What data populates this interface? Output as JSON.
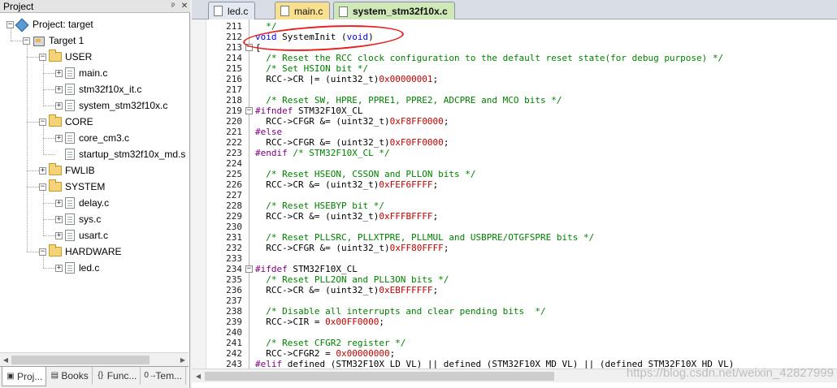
{
  "project_panel": {
    "title": "Project",
    "pin_icon": "pin-icon",
    "close_icon": "close-icon",
    "tree": [
      {
        "label": "Project: target",
        "icon": "project-icon",
        "expander": "−",
        "level": 0
      },
      {
        "label": "Target 1",
        "icon": "target-icon",
        "expander": "−",
        "level": 1
      },
      {
        "label": "USER",
        "icon": "folder-icon",
        "expander": "−",
        "level": 2
      },
      {
        "label": "main.c",
        "icon": "file-icon",
        "expander": "+",
        "level": 3
      },
      {
        "label": "stm32f10x_it.c",
        "icon": "file-icon",
        "expander": "+",
        "level": 3
      },
      {
        "label": "system_stm32f10x.c",
        "icon": "file-icon",
        "expander": "+",
        "level": 3
      },
      {
        "label": "CORE",
        "icon": "folder-icon",
        "expander": "−",
        "level": 2
      },
      {
        "label": "core_cm3.c",
        "icon": "file-icon",
        "expander": "+",
        "level": 3
      },
      {
        "label": "startup_stm32f10x_md.s",
        "icon": "file-icon",
        "expander": "",
        "level": 3
      },
      {
        "label": "FWLIB",
        "icon": "folder-icon",
        "expander": "+",
        "level": 2
      },
      {
        "label": "SYSTEM",
        "icon": "folder-icon",
        "expander": "−",
        "level": 2
      },
      {
        "label": "delay.c",
        "icon": "file-icon",
        "expander": "+",
        "level": 3
      },
      {
        "label": "sys.c",
        "icon": "file-icon",
        "expander": "+",
        "level": 3
      },
      {
        "label": "usart.c",
        "icon": "file-icon",
        "expander": "+",
        "level": 3
      },
      {
        "label": "HARDWARE",
        "icon": "folder-icon",
        "expander": "−",
        "level": 2
      },
      {
        "label": "led.c",
        "icon": "file-icon",
        "expander": "+",
        "level": 3
      }
    ],
    "bottom_tabs": [
      {
        "label": "Proj...",
        "icon": "project-tab-icon",
        "glyph": "▣"
      },
      {
        "label": "Books",
        "icon": "books-icon",
        "glyph": "▤"
      },
      {
        "label": "Func...",
        "icon": "functions-icon",
        "glyph": "{}"
      },
      {
        "label": "Tem...",
        "icon": "templates-icon",
        "glyph": "0→"
      }
    ]
  },
  "editor": {
    "tabs": [
      {
        "label": "led.c",
        "style": "plain"
      },
      {
        "label": "main.c",
        "style": "yellow"
      },
      {
        "label": "system_stm32f10x.c",
        "style": "active"
      }
    ],
    "lines": [
      {
        "n": "211",
        "fold": "",
        "parts": [
          {
            "t": "  */",
            "c": "cm"
          }
        ]
      },
      {
        "n": "212",
        "fold": "",
        "parts": [
          {
            "t": "void",
            "c": "kw"
          },
          {
            "t": " SystemInit (",
            "c": ""
          },
          {
            "t": "void",
            "c": "kw"
          },
          {
            "t": ")",
            "c": ""
          }
        ]
      },
      {
        "n": "213",
        "fold": "−",
        "parts": [
          {
            "t": "{",
            "c": ""
          }
        ]
      },
      {
        "n": "214",
        "fold": "",
        "parts": [
          {
            "t": "  /* Reset the RCC clock configuration to the default reset state(for debug purpose) */",
            "c": "cm"
          }
        ]
      },
      {
        "n": "215",
        "fold": "",
        "parts": [
          {
            "t": "  /* Set HSION bit */",
            "c": "cm"
          }
        ]
      },
      {
        "n": "216",
        "fold": "",
        "parts": [
          {
            "t": "  RCC->CR |= (uint32_t)",
            "c": ""
          },
          {
            "t": "0x00000001",
            "c": "num"
          },
          {
            "t": ";",
            "c": ""
          }
        ]
      },
      {
        "n": "217",
        "fold": "",
        "parts": [
          {
            "t": "",
            "c": ""
          }
        ]
      },
      {
        "n": "218",
        "fold": "",
        "parts": [
          {
            "t": "  /* Reset SW, HPRE, PPRE1, PPRE2, ADCPRE and MCO bits */",
            "c": "cm"
          }
        ]
      },
      {
        "n": "219",
        "fold": "−",
        "parts": [
          {
            "t": "#ifndef",
            "c": "pp"
          },
          {
            "t": " STM32F10X_CL",
            "c": ""
          }
        ]
      },
      {
        "n": "220",
        "fold": "",
        "parts": [
          {
            "t": "  RCC->CFGR &= (uint32_t)",
            "c": ""
          },
          {
            "t": "0xF8FF0000",
            "c": "num"
          },
          {
            "t": ";",
            "c": ""
          }
        ]
      },
      {
        "n": "221",
        "fold": "",
        "parts": [
          {
            "t": "#else",
            "c": "pp"
          }
        ]
      },
      {
        "n": "222",
        "fold": "",
        "parts": [
          {
            "t": "  RCC->CFGR &= (uint32_t)",
            "c": ""
          },
          {
            "t": "0xF0FF0000",
            "c": "num"
          },
          {
            "t": ";",
            "c": ""
          }
        ]
      },
      {
        "n": "223",
        "fold": "",
        "parts": [
          {
            "t": "#endif",
            "c": "pp"
          },
          {
            "t": " /* STM32F10X_CL */",
            "c": "cm"
          }
        ]
      },
      {
        "n": "224",
        "fold": "",
        "parts": [
          {
            "t": "",
            "c": ""
          }
        ]
      },
      {
        "n": "225",
        "fold": "",
        "parts": [
          {
            "t": "  /* Reset HSEON, CSSON and PLLON bits */",
            "c": "cm"
          }
        ]
      },
      {
        "n": "226",
        "fold": "",
        "parts": [
          {
            "t": "  RCC->CR &= (uint32_t)",
            "c": ""
          },
          {
            "t": "0xFEF6FFFF",
            "c": "num"
          },
          {
            "t": ";",
            "c": ""
          }
        ]
      },
      {
        "n": "227",
        "fold": "",
        "parts": [
          {
            "t": "",
            "c": ""
          }
        ]
      },
      {
        "n": "228",
        "fold": "",
        "parts": [
          {
            "t": "  /* Reset HSEBYP bit */",
            "c": "cm"
          }
        ]
      },
      {
        "n": "229",
        "fold": "",
        "parts": [
          {
            "t": "  RCC->CR &= (uint32_t)",
            "c": ""
          },
          {
            "t": "0xFFFBFFFF",
            "c": "num"
          },
          {
            "t": ";",
            "c": ""
          }
        ]
      },
      {
        "n": "230",
        "fold": "",
        "parts": [
          {
            "t": "",
            "c": ""
          }
        ]
      },
      {
        "n": "231",
        "fold": "",
        "parts": [
          {
            "t": "  /* Reset PLLSRC, PLLXTPRE, PLLMUL and USBPRE/OTGFSPRE bits */",
            "c": "cm"
          }
        ]
      },
      {
        "n": "232",
        "fold": "",
        "parts": [
          {
            "t": "  RCC->CFGR &= (uint32_t)",
            "c": ""
          },
          {
            "t": "0xFF80FFFF",
            "c": "num"
          },
          {
            "t": ";",
            "c": ""
          }
        ]
      },
      {
        "n": "233",
        "fold": "",
        "parts": [
          {
            "t": "",
            "c": ""
          }
        ]
      },
      {
        "n": "234",
        "fold": "−",
        "parts": [
          {
            "t": "#ifdef",
            "c": "pp"
          },
          {
            "t": " STM32F10X_CL",
            "c": ""
          }
        ]
      },
      {
        "n": "235",
        "fold": "",
        "parts": [
          {
            "t": "  /* Reset PLL2ON and PLL3ON bits */",
            "c": "cm"
          }
        ]
      },
      {
        "n": "236",
        "fold": "",
        "parts": [
          {
            "t": "  RCC->CR &= (uint32_t)",
            "c": ""
          },
          {
            "t": "0xEBFFFFFF",
            "c": "num"
          },
          {
            "t": ";",
            "c": ""
          }
        ]
      },
      {
        "n": "237",
        "fold": "",
        "parts": [
          {
            "t": "",
            "c": ""
          }
        ]
      },
      {
        "n": "238",
        "fold": "",
        "parts": [
          {
            "t": "  /* Disable all interrupts and clear pending bits  */",
            "c": "cm"
          }
        ]
      },
      {
        "n": "239",
        "fold": "",
        "parts": [
          {
            "t": "  RCC->CIR = ",
            "c": ""
          },
          {
            "t": "0x00FF0000",
            "c": "num"
          },
          {
            "t": ";",
            "c": ""
          }
        ]
      },
      {
        "n": "240",
        "fold": "",
        "parts": [
          {
            "t": "",
            "c": ""
          }
        ]
      },
      {
        "n": "241",
        "fold": "",
        "parts": [
          {
            "t": "  /* Reset CFGR2 register */",
            "c": "cm"
          }
        ]
      },
      {
        "n": "242",
        "fold": "",
        "parts": [
          {
            "t": "  RCC->CFGR2 = ",
            "c": ""
          },
          {
            "t": "0x00000000",
            "c": "num"
          },
          {
            "t": ";",
            "c": ""
          }
        ]
      },
      {
        "n": "243",
        "fold": "",
        "parts": [
          {
            "t": "#elif",
            "c": "pp"
          },
          {
            "t": " defined (STM32F10X_LD_VL) || defined (STM32F10X_MD_VL) || (defined STM32F10X_HD_VL)",
            "c": ""
          }
        ]
      }
    ]
  },
  "watermark": "https://blog.csdn.net/weixin_42827999",
  "colors": {
    "keyword": "#0000ff",
    "comment": "#008000",
    "number": "#c00000",
    "preprocessor": "#800080",
    "annotation": "#e82020",
    "active_tab": "#d0e7b8"
  }
}
